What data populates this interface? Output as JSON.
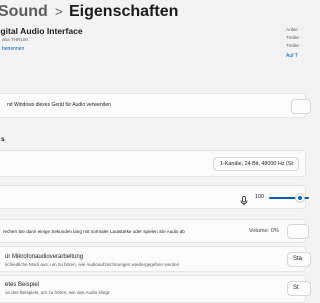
{
  "header": {
    "breadcrumb_parent": "Sound",
    "separator": ">",
    "title": "Eigenschaften"
  },
  "device": {
    "name": "igital Audio Interface",
    "maker": "aha THR10II",
    "rename_link": "benennen",
    "right_col": {
      "line1": "Anbie",
      "line2": "Treibe",
      "line3": "Treibe",
      "line4": "Auf T"
    }
  },
  "allow_row": {
    "text": "nd Windows dieses Gerät für Audio verwenden"
  },
  "section_label": "s",
  "format": {
    "selected": "1-Kanäle, 24 Bit, 48000 Hz (St"
  },
  "volume": {
    "level": 100,
    "level_text": "100"
  },
  "test_row": {
    "text": "rechen Sie dann einige Sekunden lang mit normaler Lautstärke oder spielen Sie Audio ab",
    "volume_label": "Volume: 0%"
  },
  "enhance_row": {
    "title": "ür Mikrofonaudioverarbeitung",
    "subtitle": "schiedliche Modi aus, um zu hören, wie Audioaufzeichnungen wiedergegeben werden",
    "button_label": "Sta"
  },
  "example_row": {
    "title": "etes Beispiel",
    "subtitle": "us des Beispiels, um zu hören, wie das Audio klingt",
    "button_label": "St"
  },
  "colors": {
    "accent": "#005fb8"
  }
}
